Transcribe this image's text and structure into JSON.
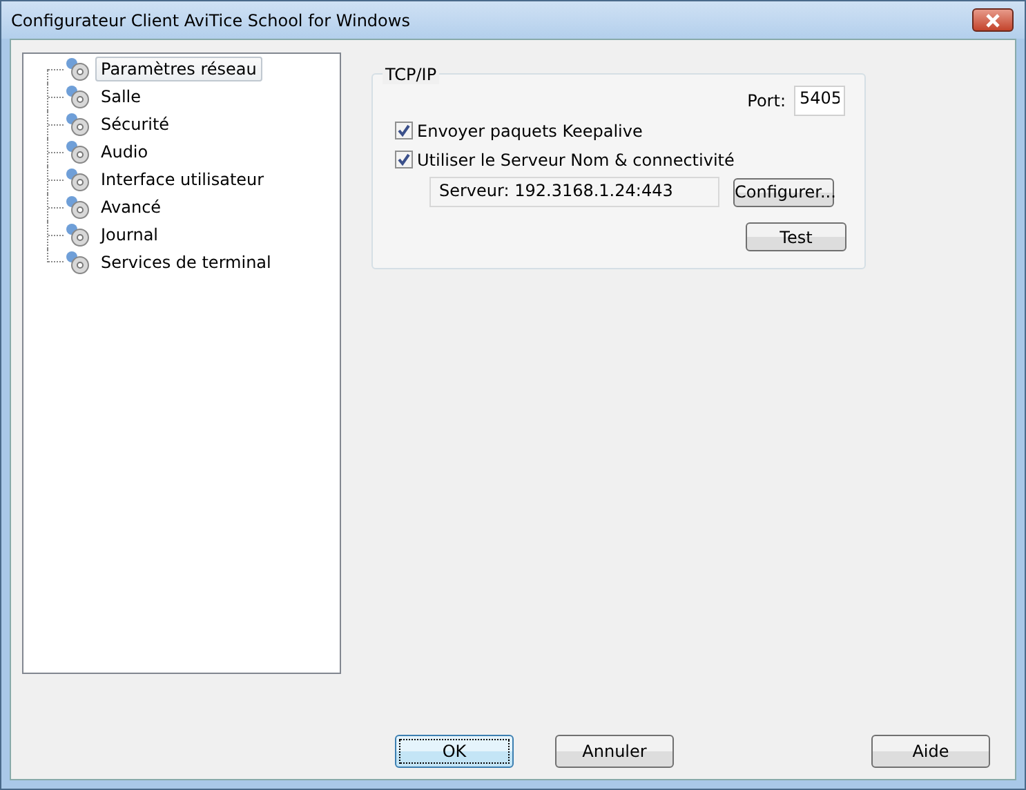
{
  "window": {
    "title": "Configurateur Client AviTice School for Windows"
  },
  "tree": {
    "items": [
      {
        "label": "Paramètres réseau",
        "selected": true
      },
      {
        "label": "Salle",
        "selected": false
      },
      {
        "label": "Sécurité",
        "selected": false
      },
      {
        "label": "Audio",
        "selected": false
      },
      {
        "label": "Interface utilisateur",
        "selected": false
      },
      {
        "label": "Avancé",
        "selected": false
      },
      {
        "label": "Journal",
        "selected": false
      },
      {
        "label": "Services de terminal",
        "selected": false
      }
    ]
  },
  "group": {
    "title": "TCP/IP",
    "port_label": "Port:",
    "port": "5405",
    "checkboxes": [
      {
        "label": "Envoyer paquets Keepalive",
        "checked": true
      },
      {
        "label": "Utiliser le Serveur Nom & connectivité",
        "checked": true
      }
    ],
    "server": "Serveur: 192.3168.1.24:443",
    "configure_button": "Configurer...",
    "test_button": "Test"
  },
  "buttons": [
    {
      "label": "OK",
      "kind": "default"
    },
    {
      "label": "Annuler",
      "kind": "normal"
    },
    {
      "label": "Aide",
      "kind": "help"
    }
  ]
}
